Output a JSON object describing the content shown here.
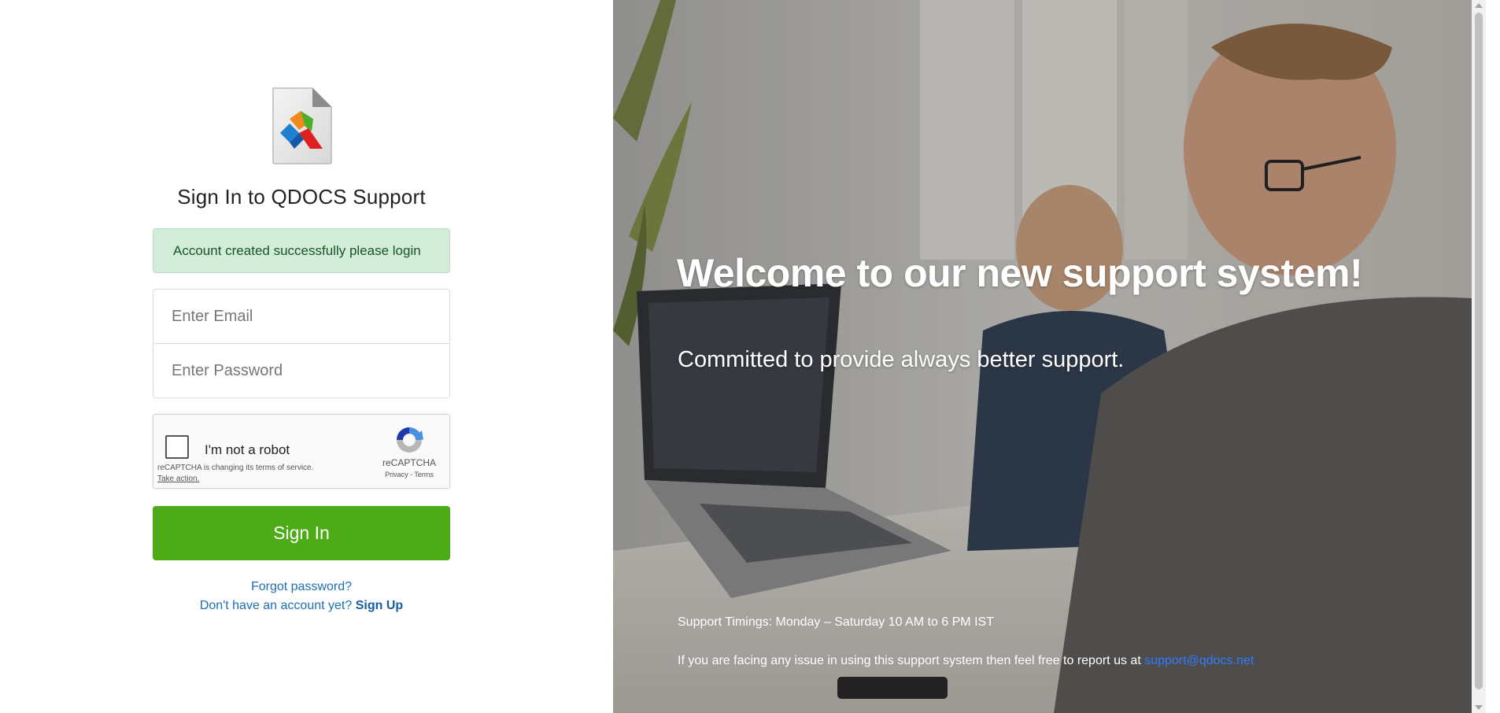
{
  "login": {
    "title": "Sign In to QDOCS Support",
    "alert": "Account created successfully please login",
    "email_placeholder": "Enter Email",
    "password_placeholder": "Enter Password",
    "signin_label": "Sign In",
    "forgot_password": "Forgot password?",
    "no_account_text": "Don't have an account yet? ",
    "signup_label": "Sign Up"
  },
  "captcha": {
    "label": "I'm not a robot",
    "notice_text": "reCAPTCHA is changing its terms of service.",
    "notice_link": "Take action.",
    "brand": "reCAPTCHA",
    "links": "Privacy - Terms"
  },
  "hero": {
    "title": "Welcome to our new support system!",
    "subtitle": "Committed to provide always better support.",
    "timings": "Support Timings: Monday – Saturday 10 AM to 6 PM IST",
    "report_text": "If you are facing any issue in using this support system then feel free to report us at ",
    "report_email": "support@qdocs.net"
  },
  "colors": {
    "signin_button": "#4cab17",
    "alert_bg": "#d4edda",
    "link": "#1d6fb6",
    "email_link": "#2f7cff"
  }
}
